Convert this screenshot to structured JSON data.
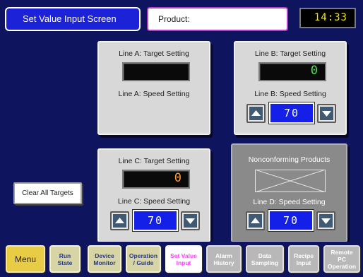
{
  "header": {
    "title": "Set Value Input Screen",
    "product_label": "Product:",
    "clock": "14:33"
  },
  "panels": {
    "line_a": {
      "target_label": "Line A: Target Setting",
      "target_value": "",
      "speed_label": "Line A: Speed Setting"
    },
    "line_b": {
      "target_label": "Line B: Target Setting",
      "target_value": "0",
      "speed_label": "Line B: Speed Setting",
      "speed_value": "70"
    },
    "line_c": {
      "target_label": "Line C: Target Setting",
      "target_value": "0",
      "speed_label": "Line C: Speed Setting",
      "speed_value": "70"
    },
    "line_d": {
      "title": "Nonconforming Products",
      "speed_label": "Line D: Speed Setting",
      "speed_value": "70"
    }
  },
  "clear_button_label": "Clear All Targets",
  "nav": [
    {
      "label": "Menu"
    },
    {
      "label": "Run\nState"
    },
    {
      "label": "Device\nMonitor"
    },
    {
      "label": "Operation\n/ Guide"
    },
    {
      "label": "Set Value\nInput"
    },
    {
      "label": "Alarm\nHistory"
    },
    {
      "label": "Data\nSampling"
    },
    {
      "label": "Recipe\nInput"
    },
    {
      "label": "Remote\nPC\nOperation"
    }
  ],
  "colors": {
    "background": "#0e145e",
    "title_box": "#1c22d8",
    "speed_value_bg": "#1420e8",
    "target_b_text": "#48e848",
    "target_c_text": "#ff9a2a",
    "clock_text": "#f5e800",
    "active_nav_text": "#ff3dff"
  },
  "icons": {
    "up": "triangle-up-icon",
    "down": "triangle-down-icon",
    "placeholder": "crossed-box-icon"
  }
}
